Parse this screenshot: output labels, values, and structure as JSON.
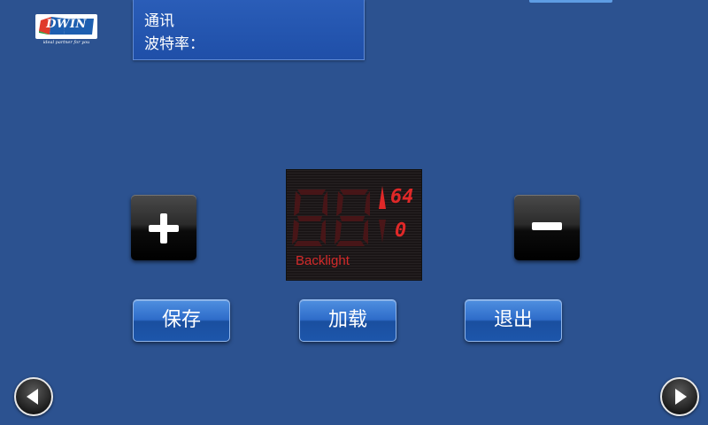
{
  "logo": {
    "text": "DWIN",
    "tagline": "ideal partner for you"
  },
  "info_panel": {
    "line1": "通讯",
    "line2": "波特率："
  },
  "controls": {
    "plus_symbol": "+",
    "minus_symbol": "−"
  },
  "display": {
    "main_digits": "88",
    "max_value": "64",
    "current_value": "0",
    "label": "Backlight",
    "color": "#e02828"
  },
  "buttons": {
    "save": "保存",
    "load": "加载",
    "exit": "退出"
  },
  "nav": {
    "prev_icon": "arrow-left-icon",
    "next_icon": "arrow-right-icon"
  },
  "colors": {
    "background": "#2c5290",
    "button_blue": "#2e6cc9",
    "display_red": "#e02828"
  }
}
